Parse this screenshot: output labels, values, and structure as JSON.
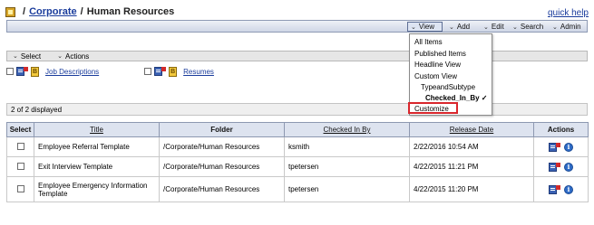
{
  "header": {
    "separator": "/",
    "breadcrumb_link": "Corporate",
    "breadcrumb_current": "Human Resources",
    "quick_help": "quick help"
  },
  "toolbar": {
    "view": "View",
    "add": "Add",
    "edit": "Edit",
    "search": "Search",
    "admin": "Admin"
  },
  "subbar": {
    "select": "Select",
    "actions": "Actions"
  },
  "links": [
    {
      "label": "Job Descriptions"
    },
    {
      "label": "Resumes"
    }
  ],
  "count_text": "2 of 2 displayed",
  "table": {
    "headers": {
      "select": "Select",
      "title": "Title",
      "folder": "Folder",
      "checked_in_by": "Checked In By",
      "release_date": "Release Date",
      "actions": "Actions"
    },
    "rows": [
      {
        "title": "Employee Referral Template",
        "folder": "/Corporate/Human Resources",
        "checked_in_by": "ksmith",
        "release_date": "2/22/2016 10:54 AM"
      },
      {
        "title": "Exit Interview Template",
        "folder": "/Corporate/Human Resources",
        "checked_in_by": "tpetersen",
        "release_date": "4/22/2015 11:21 PM"
      },
      {
        "title": "Employee Emergency Information Template",
        "folder": "/Corporate/Human Resources",
        "checked_in_by": "tpetersen",
        "release_date": "4/22/2015 11:20 PM"
      }
    ]
  },
  "view_menu": {
    "all_items": "All Items",
    "published_items": "Published Items",
    "headline_view": "Headline View",
    "custom_view": "Custom View",
    "type_and_subtype": "TypeandSubtype",
    "checked_in_by": "Checked_In_By ✓",
    "customize": "Customize"
  },
  "colors": {
    "highlight_border": "#d9262c",
    "link": "#1a3c9c"
  }
}
